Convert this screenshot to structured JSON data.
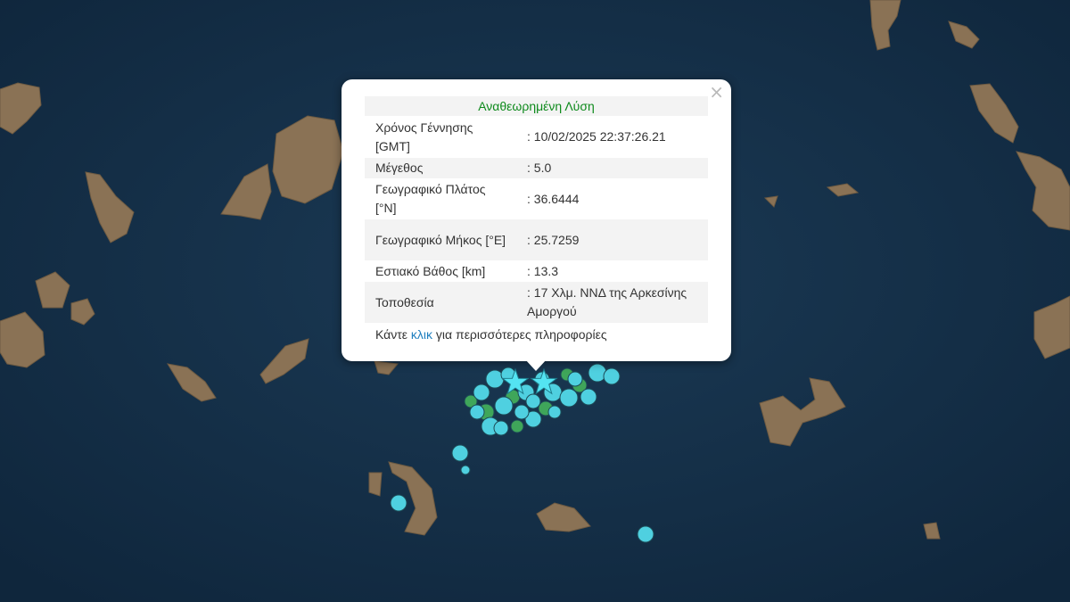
{
  "popup": {
    "close": "×",
    "title": "Αναθεωρημένη Λύση",
    "rows": [
      {
        "label": "Χρόνος Γέννησης [GMT]",
        "value": ": 10/02/2025 22:37:26.21"
      },
      {
        "label": "Μέγεθος",
        "value": ": 5.0"
      },
      {
        "label": "Γεωγραφικό Πλάτος [°N]",
        "value": ": 36.6444"
      },
      {
        "label": "Γεωγραφικό Μήκος [°E]",
        "value": ": 25.7259"
      },
      {
        "label": "Εστιακό Βάθος [km]",
        "value": ": 13.3"
      },
      {
        "label": "Τοποθεσία",
        "value": ": 17 Χλμ. ΝΝΔ της Αρκεσίνης Αμοργού"
      }
    ],
    "more_before": "Κάντε ",
    "more_link": "κλικ",
    "more_after": " για περισσότερες πληροφορίες"
  },
  "colors": {
    "sea": "#16304a",
    "land": "#8a7255",
    "quake_cyan": "#4fd0e0",
    "quake_green": "#3fa65a",
    "star": "#54e4f2"
  },
  "icons": {
    "star": "star-icon",
    "close": "close-icon"
  }
}
